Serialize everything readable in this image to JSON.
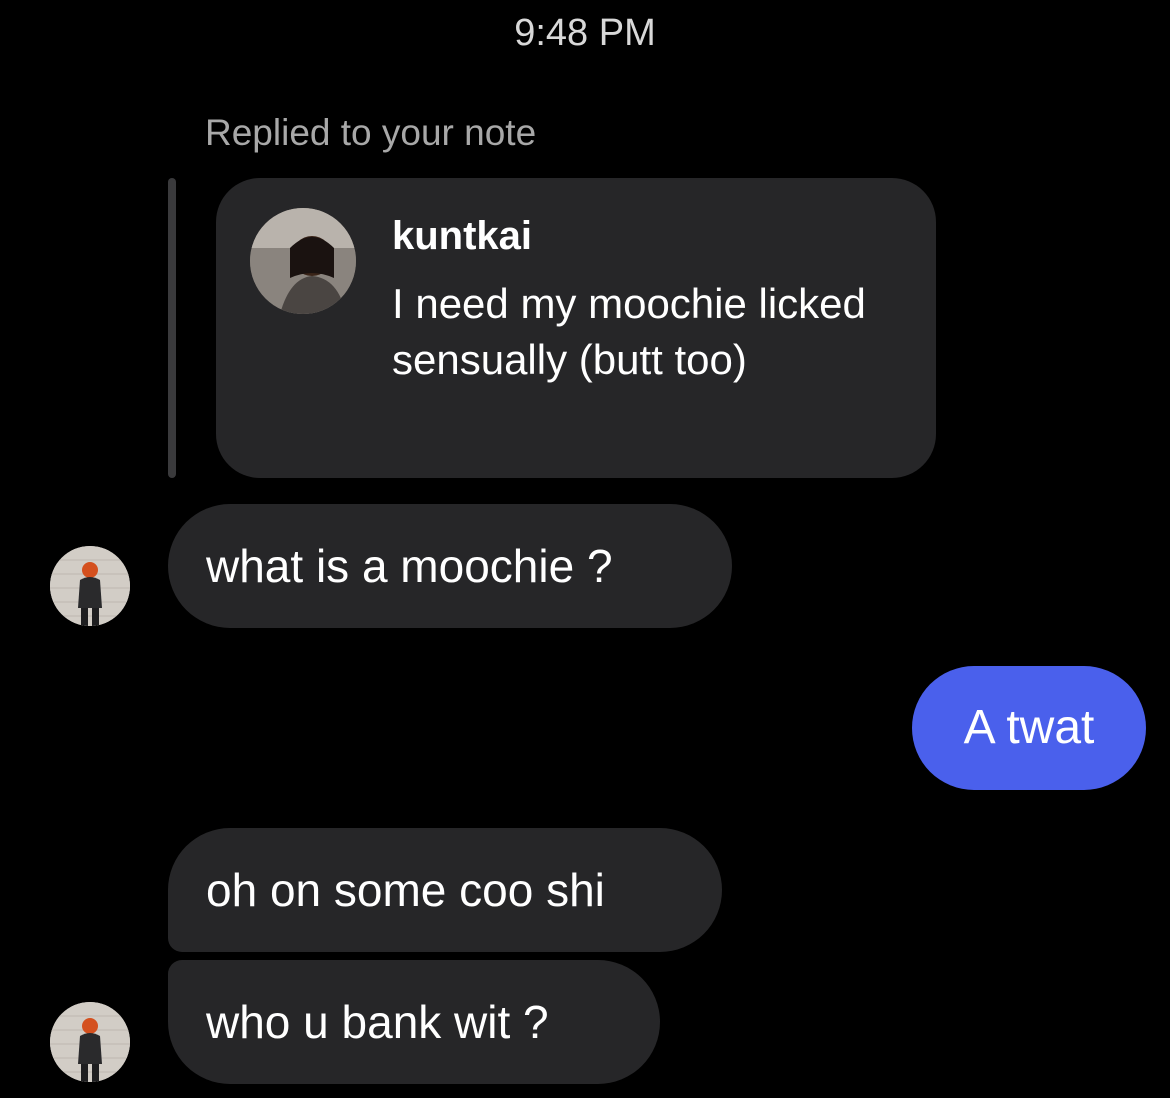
{
  "header": {
    "timestamp": "9:48 PM"
  },
  "note_reply": {
    "caption": "Replied to your note",
    "username": "kuntkai",
    "text": "I need my moochie licked sensually (butt too)",
    "avatar_icon": "profile-photo"
  },
  "messages": [
    {
      "direction": "incoming",
      "text": "what is a moochie ?"
    },
    {
      "direction": "outgoing",
      "text": "A twat"
    },
    {
      "direction": "incoming",
      "text": "oh on some coo shi"
    },
    {
      "direction": "incoming",
      "text": "who u bank wit ?"
    }
  ],
  "colors": {
    "background": "#000000",
    "incoming_bubble": "#262628",
    "outgoing_bubble": "#4a60ec",
    "secondary_text": "#a8a8a8"
  }
}
